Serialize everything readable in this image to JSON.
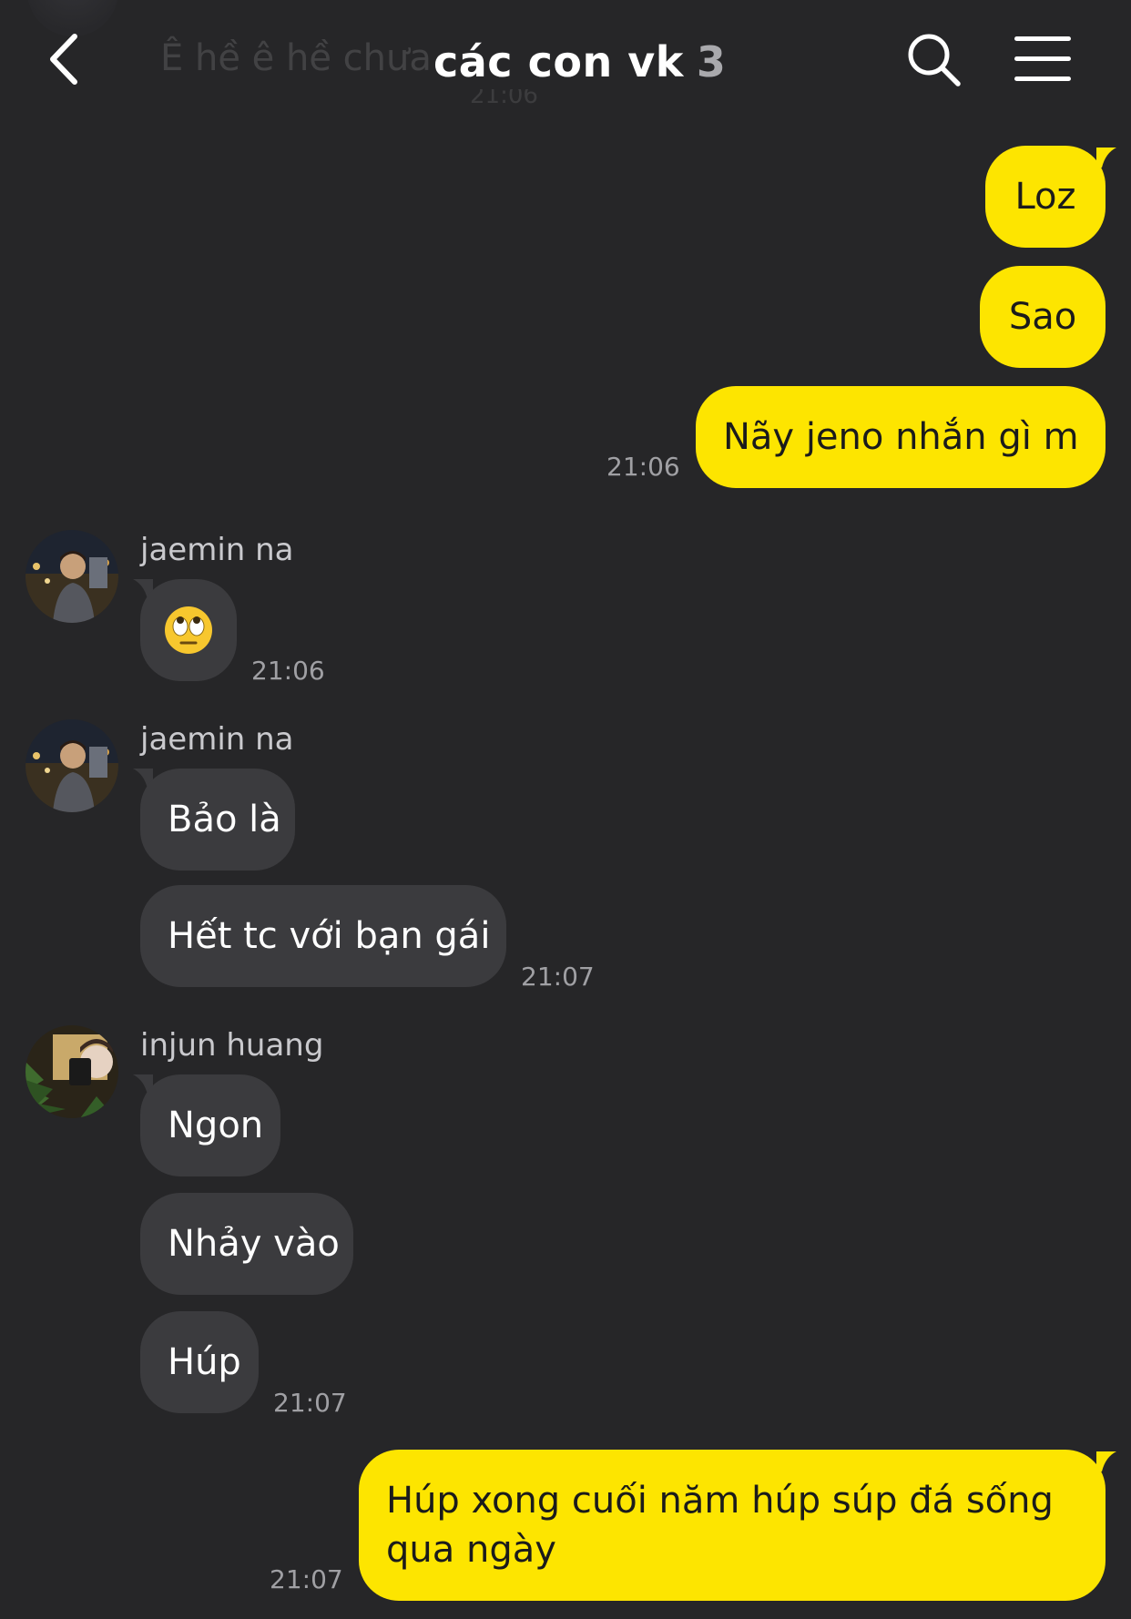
{
  "header": {
    "title": "các con vk",
    "member_count": "3",
    "ghost_preview_text": "Ê hề ê hề chưa",
    "ghost_preview_time": "21:06"
  },
  "messages": {
    "out_1": {
      "text": "Loz"
    },
    "out_2": {
      "text": "Sao"
    },
    "out_3": {
      "text": "Nãy jeno nhắn gì m",
      "time": "21:06"
    },
    "jaemin_1": {
      "sender": "jaemin na",
      "emoji": "eye-roll-emoji",
      "time": "21:06"
    },
    "jaemin_2": {
      "sender": "jaemin na",
      "line1": "Bảo là",
      "line2": "Hết tc với bạn gái",
      "time": "21:07"
    },
    "injun": {
      "sender": "injun huang",
      "line1": "Ngon",
      "line2": "Nhảy vào",
      "line3": "Húp",
      "time": "21:07"
    },
    "out_4": {
      "line1": "Húp xong cuối năm húp súp đá sống",
      "line2": "qua ngày",
      "time": "21:07"
    }
  },
  "colors": {
    "background": "#262628",
    "outgoing_bubble": "#fde500",
    "incoming_bubble": "#3b3b3e",
    "timestamp": "#a0a0a4"
  },
  "icons": {
    "back": "chevron-left-icon",
    "search": "search-icon",
    "menu": "hamburger-menu-icon"
  }
}
